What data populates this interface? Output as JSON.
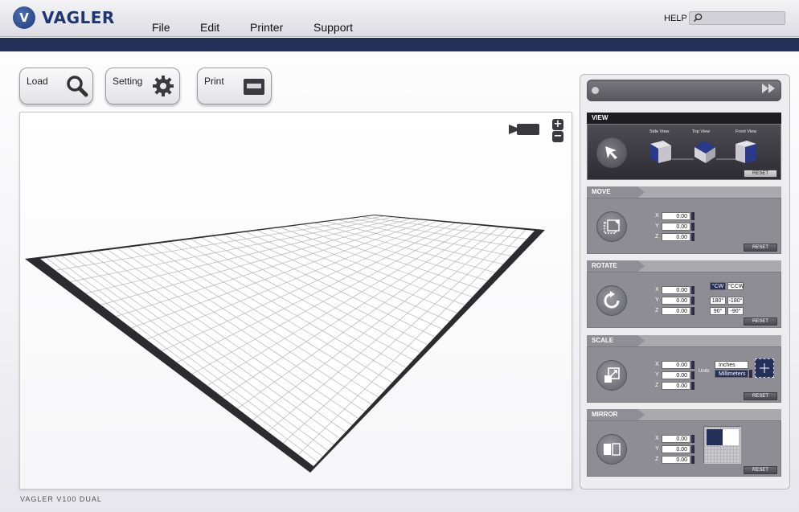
{
  "app": {
    "brand": "VAGLER",
    "logo_letter": "V",
    "model": "VAGLER V100 DUAL"
  },
  "menu": [
    "File",
    "Edit",
    "Printer",
    "Support"
  ],
  "help": {
    "label": "HELP",
    "search_icon": "magnifier-icon"
  },
  "toolbar": {
    "load": {
      "label": "Load",
      "icon": "search-icon"
    },
    "setting": {
      "label": "Setting",
      "icon": "gear-icon"
    },
    "print": {
      "label": "Print",
      "icon": "print-icon"
    }
  },
  "viewport": {
    "zoom_in": "+",
    "zoom_out": "−",
    "camera_icon": "camera-icon"
  },
  "panel": {
    "progress": {
      "fraction": 0.0,
      "forward_icon": "fast-forward-icon"
    },
    "view": {
      "title": "VIEW",
      "views": [
        "Side View",
        "Top View",
        "Front View"
      ],
      "reset": "RESET"
    },
    "move": {
      "title": "MOVE",
      "axes": [
        {
          "axis": "X",
          "value": "0.00"
        },
        {
          "axis": "Y",
          "value": "0.00"
        },
        {
          "axis": "Z",
          "value": "0.00"
        }
      ],
      "reset": "RESET"
    },
    "rotate": {
      "title": "ROTATE",
      "axes": [
        {
          "axis": "X",
          "value": "0.00"
        },
        {
          "axis": "Y",
          "value": "0.00"
        },
        {
          "axis": "Z",
          "value": "0.00"
        }
      ],
      "buttons": [
        [
          "°CW",
          "°CCW"
        ],
        [
          "180°",
          "-180°"
        ],
        [
          "90°",
          "-90°"
        ]
      ],
      "selected": "°CW",
      "reset": "RESET"
    },
    "scale": {
      "title": "SCALE",
      "axes": [
        {
          "axis": "X",
          "value": "0.00"
        },
        {
          "axis": "Y",
          "value": "0.00"
        },
        {
          "axis": "Z",
          "value": "0.00"
        }
      ],
      "units_label": "Units",
      "units": [
        "Inches",
        "Millimeters"
      ],
      "selected_unit": "Millimeters",
      "reset": "RESET"
    },
    "mirror": {
      "title": "MIRROR",
      "axes": [
        {
          "axis": "X",
          "value": "0.00"
        },
        {
          "axis": "Y",
          "value": "0.00"
        },
        {
          "axis": "Z",
          "value": "0.00"
        }
      ],
      "reset": "RESET"
    }
  },
  "colors": {
    "navy": "#23305a",
    "brand_blue": "#1f3673",
    "panel_gray": "#8d8d93"
  }
}
